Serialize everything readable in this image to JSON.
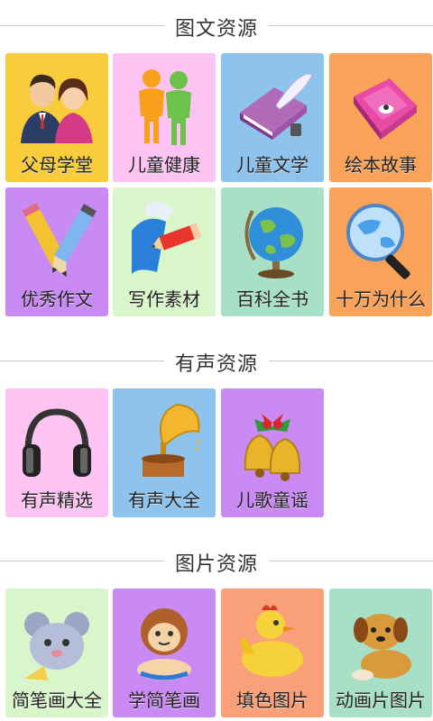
{
  "sections": [
    {
      "title": "图文资源",
      "tiles": [
        {
          "label": "父母学堂",
          "icon": "parents-icon",
          "color": "#f8cc3a"
        },
        {
          "label": "儿童健康",
          "icon": "children-health-icon",
          "color": "#fdc3f3"
        },
        {
          "label": "儿童文学",
          "icon": "book-quill-icon",
          "color": "#8ec3ee"
        },
        {
          "label": "绘本故事",
          "icon": "storybook-icon",
          "color": "#f9a35a"
        },
        {
          "label": "优秀作文",
          "icon": "pencils-icon",
          "color": "#c98af3"
        },
        {
          "label": "写作素材",
          "icon": "pencil-paper-icon",
          "color": "#d8f6c9"
        },
        {
          "label": "百科全书",
          "icon": "globe-icon",
          "color": "#a7e0c7"
        },
        {
          "label": "十万为什么",
          "icon": "magnifier-globe-icon",
          "color": "#f9a35a"
        }
      ]
    },
    {
      "title": "有声资源",
      "tiles": [
        {
          "label": "有声精选",
          "icon": "headphones-icon",
          "color": "#fdc3f3"
        },
        {
          "label": "有声大全",
          "icon": "gramophone-icon",
          "color": "#8ec3ee"
        },
        {
          "label": "儿歌童谣",
          "icon": "christmas-bells-icon",
          "color": "#c98af3"
        }
      ]
    },
    {
      "title": "图片资源",
      "tiles": [
        {
          "label": "简笔画大全",
          "icon": "mouse-cheese-icon",
          "color": "#d8f6c9"
        },
        {
          "label": "学简笔画",
          "icon": "monkey-icon",
          "color": "#c98af3"
        },
        {
          "label": "填色图片",
          "icon": "duckling-icon",
          "color": "#f9a078"
        },
        {
          "label": "动画片图片",
          "icon": "puppy-icon",
          "color": "#a7e0c7"
        }
      ]
    }
  ]
}
